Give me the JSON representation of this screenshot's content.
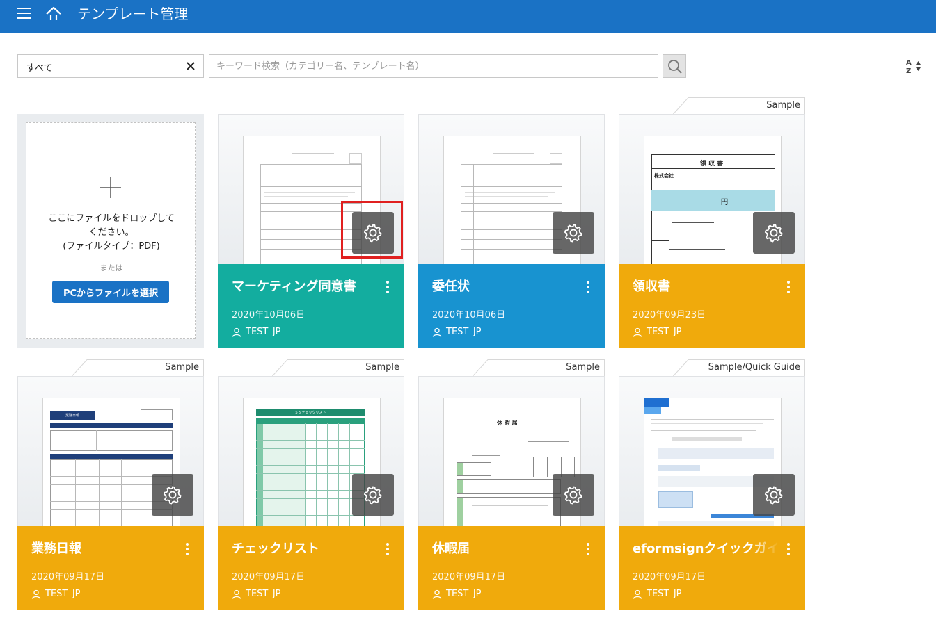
{
  "header": {
    "title": "テンプレート管理",
    "menu_icon": "hamburger-icon",
    "home_icon": "home-icon",
    "bg_color": "#1a72c5"
  },
  "toolbar": {
    "category_value": "すべて",
    "search_placeholder": "キーワード検索（カテゴリー名、テンプレート名）",
    "search_value": ""
  },
  "upload": {
    "drop_text_1": "ここにファイルをドロップして",
    "drop_text_2": "ください。",
    "drop_text_3": "(ファイルタイプ：PDF)",
    "or_text": "または",
    "button_label": "PCからファイルを選択"
  },
  "colors": {
    "teal": "#13ad9f",
    "blue": "#1893d0",
    "amber": "#f0aa0c"
  },
  "cards": [
    {
      "title": "マーケティング同意書",
      "date": "2020年10月06日",
      "owner": "TEST_JP",
      "tag": "",
      "color": "teal"
    },
    {
      "title": "委任状",
      "date": "2020年10月06日",
      "owner": "TEST_JP",
      "tag": "",
      "color": "blue"
    },
    {
      "title": "領収書",
      "date": "2020年09月23日",
      "owner": "TEST_JP",
      "tag": "Sample",
      "color": "amber"
    },
    {
      "title": "業務日報",
      "date": "2020年09月17日",
      "owner": "TEST_JP",
      "tag": "Sample",
      "color": "amber"
    },
    {
      "title": "チェックリスト",
      "date": "2020年09月17日",
      "owner": "TEST_JP",
      "tag": "Sample",
      "color": "amber"
    },
    {
      "title": "休暇届",
      "date": "2020年09月17日",
      "owner": "TEST_JP",
      "tag": "Sample",
      "color": "amber"
    },
    {
      "title": "eformsignクイックガイド",
      "date": "2020年09月17日",
      "owner": "TEST_JP",
      "tag": "Sample/Quick Guide",
      "color": "amber"
    }
  ],
  "thumb_text": {
    "receipt_title": "領 収 書",
    "receipt_company": "株式会社",
    "receipt_yen": "円",
    "leave_title": "休 暇 届",
    "checklist_title": "５Ｓチェックリスト",
    "report_title": "業務日報"
  }
}
